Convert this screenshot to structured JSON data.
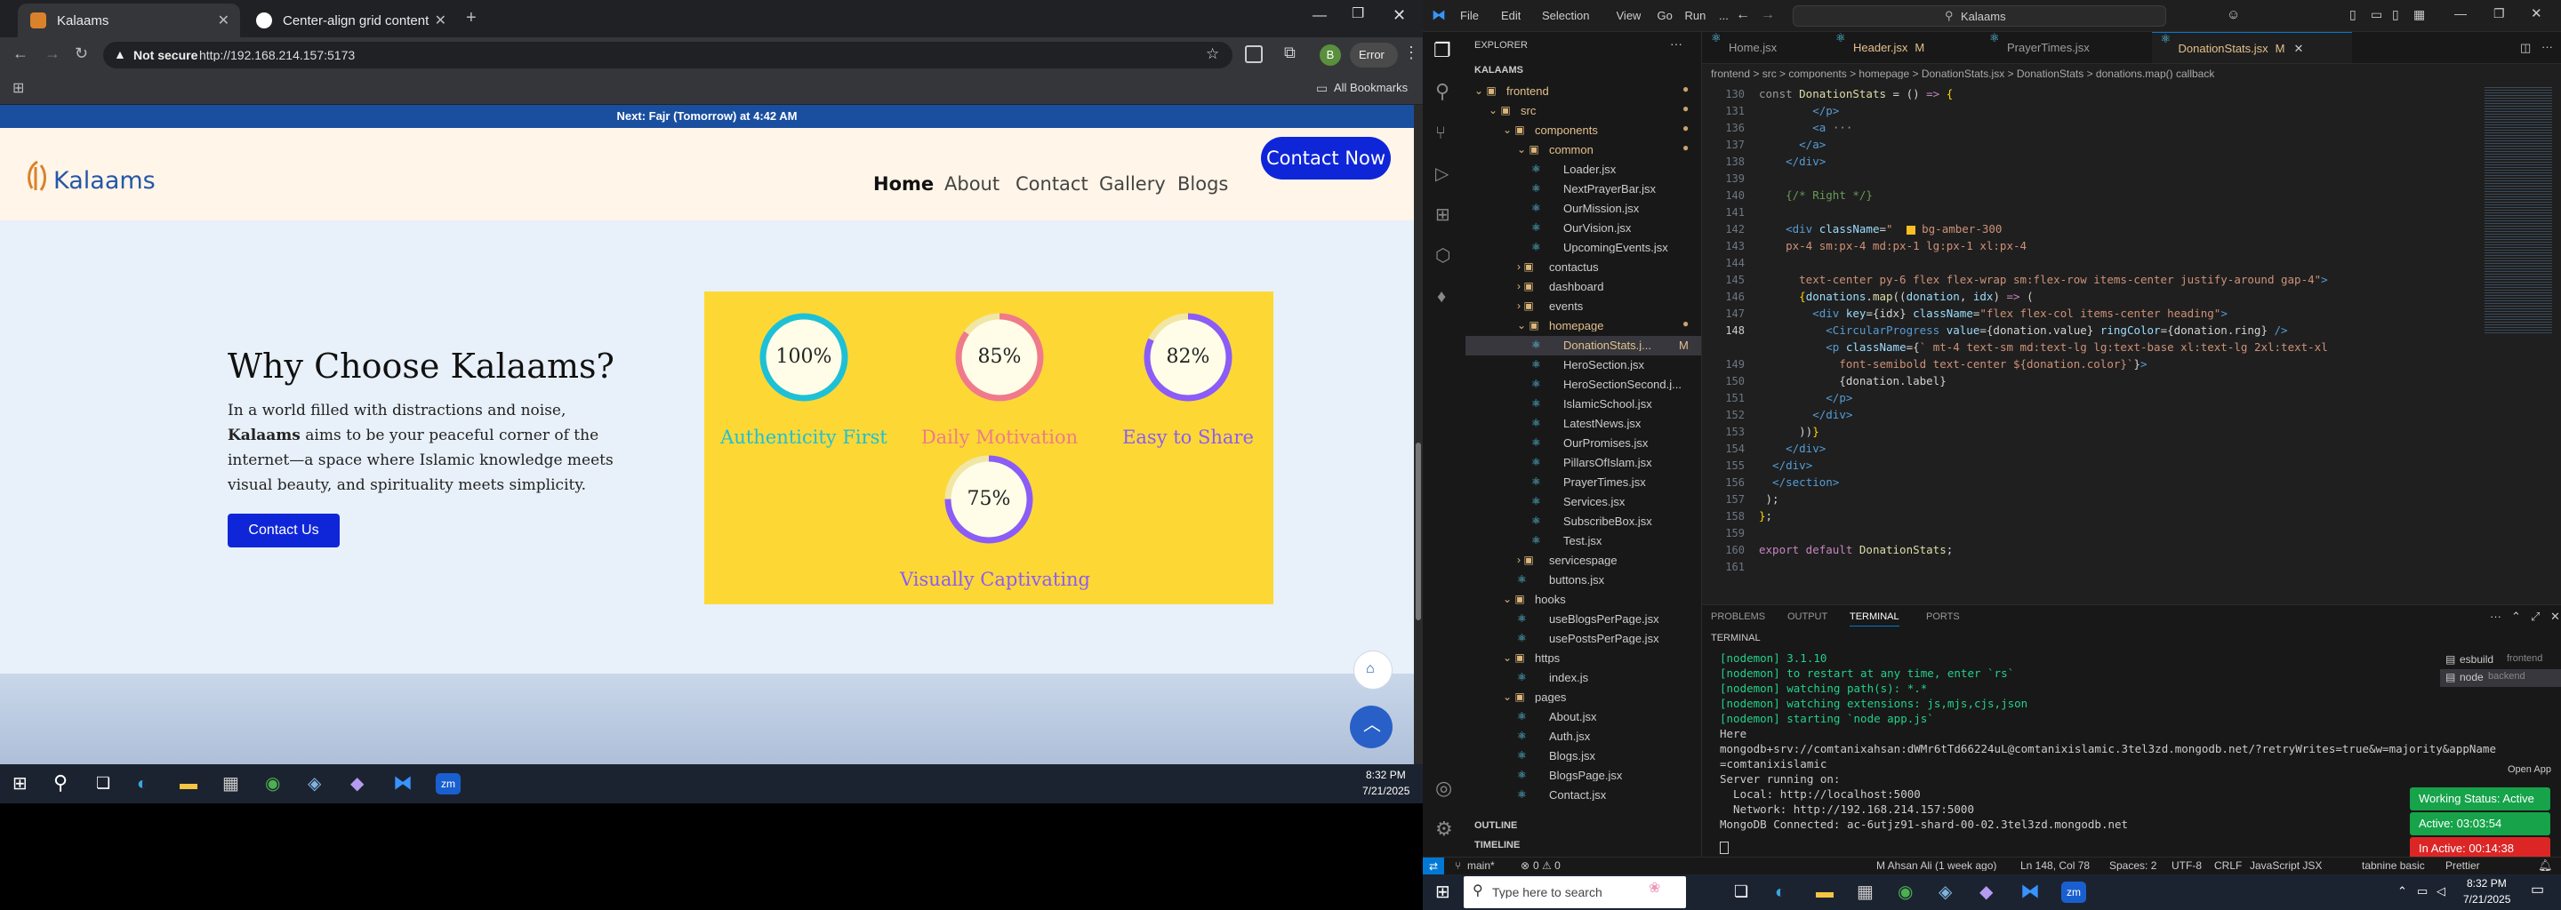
{
  "browser": {
    "tabs": [
      {
        "title": "Kalaams",
        "active": true
      },
      {
        "title": "Center-align grid content",
        "active": false
      }
    ],
    "address": {
      "security": "Not secure",
      "url": "http://192.168.214.157:5173"
    },
    "profile_initial": "B",
    "error_label": "Error",
    "bookmarks_label": "All Bookmarks"
  },
  "site": {
    "announcement": "Next: Fajr (Tomorrow) at 4:42 AM",
    "brand": "Kalaams",
    "nav": [
      "Home",
      "About",
      "Contact",
      "Gallery",
      "Blogs"
    ],
    "nav_cta": "Contact Now",
    "section_title": "Why Choose Kalaams?",
    "intro_before": "In a world filled with distractions and noise, ",
    "intro_strong": "Kalaams",
    "intro_after": " aims to be your peaceful corner of the internet—a space where Islamic knowledge meets visual beauty, and spirituality meets simplicity.",
    "cta": "Contact Us",
    "stats": [
      {
        "value": 100,
        "display": "100%",
        "label": "Authenticity First",
        "color": "#1ec0d6"
      },
      {
        "value": 85,
        "display": "85%",
        "label": "Daily Motivation",
        "color": "#f07a8a"
      },
      {
        "value": 82,
        "display": "82%",
        "label": "Easy to Share",
        "color": "#8b5cf6"
      },
      {
        "value": 75,
        "display": "75%",
        "label": "Visually Captivating",
        "color": "#8b5cf6"
      }
    ],
    "stat_box_color": "#fdd835",
    "primary_color": "#0f26d8"
  },
  "taskbar_left": {
    "time": "8:32 PM",
    "date": "7/21/2025"
  },
  "vscode": {
    "menu": [
      "File",
      "Edit",
      "Selection",
      "View",
      "Go",
      "Run",
      "..."
    ],
    "search": "Kalaams",
    "explorer_title": "EXPLORER",
    "root": "KALAAMS",
    "tree": [
      {
        "name": "frontend",
        "depth": 0,
        "kind": "folder",
        "mod": true
      },
      {
        "name": "src",
        "depth": 1,
        "kind": "folder",
        "mod": true
      },
      {
        "name": "components",
        "depth": 2,
        "kind": "folder",
        "mod": true
      },
      {
        "name": "common",
        "depth": 3,
        "kind": "folder",
        "mod": true
      },
      {
        "name": "Loader.jsx",
        "depth": 4,
        "kind": "file"
      },
      {
        "name": "NextPrayerBar.jsx",
        "depth": 4,
        "kind": "file"
      },
      {
        "name": "OurMission.jsx",
        "depth": 4,
        "kind": "file"
      },
      {
        "name": "OurVision.jsx",
        "depth": 4,
        "kind": "file"
      },
      {
        "name": "UpcomingEvents.jsx",
        "depth": 4,
        "kind": "file"
      },
      {
        "name": "contactus",
        "depth": 3,
        "kind": "folder-closed"
      },
      {
        "name": "dashboard",
        "depth": 3,
        "kind": "folder-closed"
      },
      {
        "name": "events",
        "depth": 3,
        "kind": "folder-closed"
      },
      {
        "name": "homepage",
        "depth": 3,
        "kind": "folder",
        "mod": true
      },
      {
        "name": "DonationStats.j...",
        "depth": 4,
        "kind": "file",
        "selected": true,
        "badge": "M"
      },
      {
        "name": "HeroSection.jsx",
        "depth": 4,
        "kind": "file"
      },
      {
        "name": "HeroSectionSecond.j...",
        "depth": 4,
        "kind": "file"
      },
      {
        "name": "IslamicSchool.jsx",
        "depth": 4,
        "kind": "file"
      },
      {
        "name": "LatestNews.jsx",
        "depth": 4,
        "kind": "file"
      },
      {
        "name": "OurPromises.jsx",
        "depth": 4,
        "kind": "file"
      },
      {
        "name": "PillarsOfIslam.jsx",
        "depth": 4,
        "kind": "file"
      },
      {
        "name": "PrayerTimes.jsx",
        "depth": 4,
        "kind": "file"
      },
      {
        "name": "Services.jsx",
        "depth": 4,
        "kind": "file"
      },
      {
        "name": "SubscribeBox.jsx",
        "depth": 4,
        "kind": "file"
      },
      {
        "name": "Test.jsx",
        "depth": 4,
        "kind": "file"
      },
      {
        "name": "servicespage",
        "depth": 3,
        "kind": "folder-closed"
      },
      {
        "name": "buttons.jsx",
        "depth": 3,
        "kind": "file"
      },
      {
        "name": "hooks",
        "depth": 2,
        "kind": "folder"
      },
      {
        "name": "useBlogsPerPage.jsx",
        "depth": 3,
        "kind": "file"
      },
      {
        "name": "usePostsPerPage.jsx",
        "depth": 3,
        "kind": "file"
      },
      {
        "name": "https",
        "depth": 2,
        "kind": "folder"
      },
      {
        "name": "index.js",
        "depth": 3,
        "kind": "file"
      },
      {
        "name": "pages",
        "depth": 2,
        "kind": "folder"
      },
      {
        "name": "About.jsx",
        "depth": 3,
        "kind": "file"
      },
      {
        "name": "Auth.jsx",
        "depth": 3,
        "kind": "file"
      },
      {
        "name": "Blogs.jsx",
        "depth": 3,
        "kind": "file"
      },
      {
        "name": "BlogsPage.jsx",
        "depth": 3,
        "kind": "file"
      },
      {
        "name": "Contact.jsx",
        "depth": 3,
        "kind": "file"
      }
    ],
    "outline_label": "OUTLINE",
    "timeline_label": "TIMELINE",
    "editor_tabs": [
      {
        "title": "Home.jsx",
        "badge": "",
        "active": false
      },
      {
        "title": "Header.jsx",
        "badge": "M",
        "active": false
      },
      {
        "title": "PrayerTimes.jsx",
        "badge": "",
        "active": false
      },
      {
        "title": "DonationStats.jsx",
        "badge": "M",
        "active": true
      }
    ],
    "breadcrumb": "frontend > src > components > homepage > DonationStats.jsx > DonationStats > donations.map() callback",
    "line_numbers": [
      "130",
      "131",
      "136",
      "137",
      "138",
      "139",
      "140",
      "141",
      "142",
      "143",
      "144",
      "145",
      "146",
      "147",
      "148",
      "",
      "149",
      "150",
      "151",
      "152",
      "153",
      "154",
      "155",
      "156",
      "157",
      "158",
      "159",
      "160",
      "161"
    ],
    "panel_tabs": [
      "PROBLEMS",
      "OUTPUT",
      "TERMINAL",
      "PORTS"
    ],
    "terminal_label": "TERMINAL",
    "terminal": [
      "[nodemon] 3.1.10",
      "[nodemon] to restart at any time, enter `rs`",
      "[nodemon] watching path(s): *.*",
      "[nodemon] watching extensions: js,mjs,cjs,json",
      "[nodemon] starting `node app.js`",
      "Here",
      "mongodb+srv://comtanixahsan:dWMr6tTd66224uL@comtanixislamic.3tel3zd.mongodb.net/?retryWrites=true&w=majority&appName",
      "=comtanixislamic",
      "Server running on:",
      "  Local: http://localhost:5000",
      "  Network: http://192.168.214.157:5000",
      "MongoDB Connected: ac-6utjz91-shard-00-02.3tel3zd.mongodb.net"
    ],
    "terminals": [
      {
        "name": "esbuild",
        "folder": "frontend"
      },
      {
        "name": "node",
        "folder": "backend"
      }
    ],
    "open_app": "Open App",
    "timer": {
      "status": "Working Status: Active",
      "active": "Active: 03:03:54",
      "inactive": "In Active: 00:14:38"
    },
    "status_bar": {
      "branch": "main*",
      "problems": "0 ⚠ 0",
      "author": "M Ahsan Ali (1 week ago)",
      "position": "Ln 148, Col 78",
      "spaces": "Spaces: 2",
      "encoding": "UTF-8",
      "eol": "CRLF",
      "language": "JavaScript JSX",
      "tabnine": "tabnine basic",
      "prettier": "Prettier"
    }
  },
  "taskbar_right": {
    "search_placeholder": "Type here to search",
    "time": "8:32 PM",
    "date": "7/21/2025"
  }
}
